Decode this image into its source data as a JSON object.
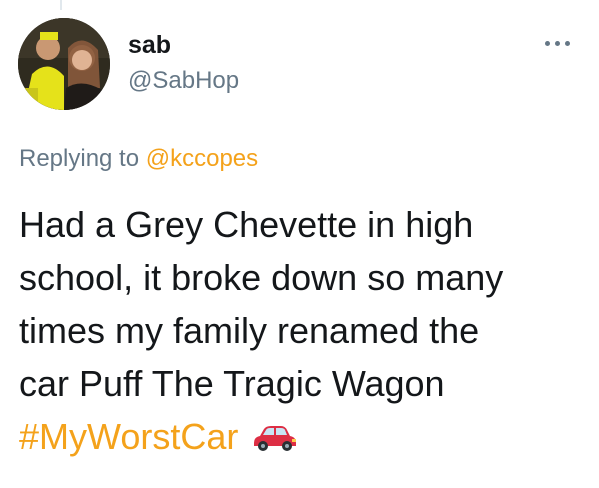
{
  "author": {
    "display_name": "sab",
    "handle": "@SabHop"
  },
  "reply": {
    "prefix": "Replying to ",
    "mention": "@kccopes"
  },
  "tweet": {
    "lines": [
      "Had a Grey Chevette in high",
      "school, it broke down so many",
      "times my family renamed the",
      "car Puff The Tragic Wagon"
    ],
    "hashtag": "#MyWorstCar",
    "emoji": "red-car-icon"
  },
  "colors": {
    "accent": "#f4a21b",
    "text": "#14171a",
    "secondary": "#657786"
  },
  "icons": {
    "more": "more-options-icon",
    "car": "red-car-icon"
  }
}
